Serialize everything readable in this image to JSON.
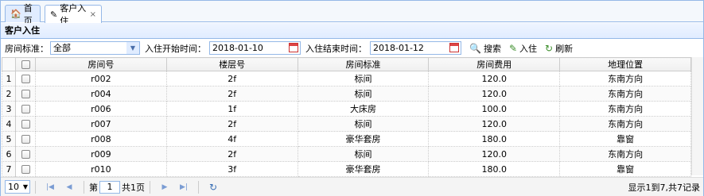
{
  "tabs": [
    {
      "label": "首页",
      "icon": "home-icon"
    },
    {
      "label": "客户入住",
      "icon": "checkin-icon",
      "close": "×"
    }
  ],
  "panel": {
    "title": "客户入住"
  },
  "toolbar": {
    "room_std_label": "房间标准：",
    "room_std_value": "全部",
    "start_label": "入住开始时间：",
    "start_value": "2018-01-10",
    "end_label": "入住结束时间：",
    "end_value": "2018-01-12",
    "search_label": "搜索",
    "checkin_label": "入住",
    "refresh_label": "刷新"
  },
  "table": {
    "columns": [
      "房间号",
      "楼层号",
      "房间标准",
      "房间费用",
      "地理位置"
    ],
    "rows": [
      {
        "num": "1",
        "room": "r002",
        "floor": "2f",
        "std": "标间",
        "fee": "120.0",
        "loc": "东南方向"
      },
      {
        "num": "2",
        "room": "r004",
        "floor": "2f",
        "std": "标间",
        "fee": "120.0",
        "loc": "东南方向"
      },
      {
        "num": "3",
        "room": "r006",
        "floor": "1f",
        "std": "大床房",
        "fee": "100.0",
        "loc": "东南方向"
      },
      {
        "num": "4",
        "room": "r007",
        "floor": "2f",
        "std": "标间",
        "fee": "120.0",
        "loc": "东南方向"
      },
      {
        "num": "5",
        "room": "r008",
        "floor": "4f",
        "std": "豪华套房",
        "fee": "180.0",
        "loc": "靠窗"
      },
      {
        "num": "6",
        "room": "r009",
        "floor": "2f",
        "std": "标间",
        "fee": "120.0",
        "loc": "东南方向"
      },
      {
        "num": "7",
        "room": "r010",
        "floor": "3f",
        "std": "豪华套房",
        "fee": "180.0",
        "loc": "靠窗"
      }
    ]
  },
  "pager": {
    "page_size": "10",
    "page_prefix": "第",
    "page_value": "1",
    "page_suffix": "共1页",
    "info": "显示1到7,共7记录"
  }
}
